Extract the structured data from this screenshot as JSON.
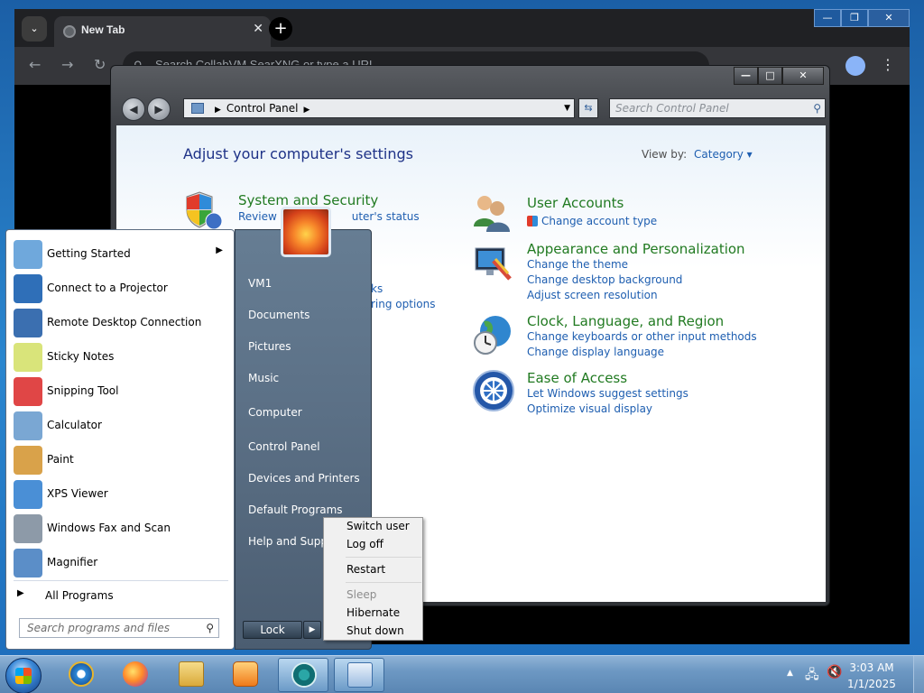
{
  "chrome": {
    "tab_title": "New Tab",
    "tab_close": "✕",
    "new_tab": "+",
    "omnibox_placeholder": "Search CollabVM SearXNG or type a URL",
    "win_min": "—",
    "win_max": "❐",
    "win_close": "✕"
  },
  "control_panel": {
    "address_root": "Control Panel",
    "search_placeholder": "Search Control Panel",
    "heading": "Adjust your computer's settings",
    "view_by_label": "View by:",
    "view_by_value": "Category ▾",
    "categories": [
      {
        "title": "System and Security",
        "icon": "shield-icon",
        "links": [
          "Review your computer's status",
          "",
          "",
          "ks",
          "ring options"
        ]
      },
      {
        "title": "User Accounts",
        "icon": "users-icon",
        "links": [
          "Change account type"
        ]
      },
      {
        "title": "Appearance and Personalization",
        "icon": "monitor-icon",
        "links": [
          "Change the theme",
          "Change desktop background",
          "Adjust screen resolution"
        ]
      },
      {
        "title": "Clock, Language, and Region",
        "icon": "globe-clock-icon",
        "links": [
          "Change keyboards or other input methods",
          "Change display language"
        ]
      },
      {
        "title": "Ease of Access",
        "icon": "ease-of-access-icon",
        "links": [
          "Let Windows suggest settings",
          "Optimize visual display"
        ]
      }
    ],
    "system_link_fragment": "Review y",
    "system_link_fragment2": "uter's status"
  },
  "start_menu": {
    "programs": [
      {
        "label": "Getting Started",
        "icon": "getting-started-icon",
        "submenu": "▶",
        "color": "#6fa8dc"
      },
      {
        "label": "Connect to a Projector",
        "icon": "projector-icon",
        "color": "#2f6fb8"
      },
      {
        "label": "Remote Desktop Connection",
        "icon": "remote-desktop-icon",
        "color": "#3b6fb0"
      },
      {
        "label": "Sticky Notes",
        "icon": "sticky-notes-icon",
        "color": "#d9e47a"
      },
      {
        "label": "Snipping Tool",
        "icon": "scissors-icon",
        "color": "#e04646"
      },
      {
        "label": "Calculator",
        "icon": "calculator-icon",
        "color": "#7aa7d3"
      },
      {
        "label": "Paint",
        "icon": "paint-icon",
        "color": "#d9a24a"
      },
      {
        "label": "XPS Viewer",
        "icon": "xps-viewer-icon",
        "color": "#4a8fd6"
      },
      {
        "label": "Windows Fax and Scan",
        "icon": "fax-scan-icon",
        "color": "#8d9aa8"
      },
      {
        "label": "Magnifier",
        "icon": "magnifier-icon",
        "color": "#5b8ec8"
      }
    ],
    "all_programs": "All Programs",
    "search_placeholder": "Search programs and files",
    "places": [
      "VM1",
      "Documents",
      "Pictures",
      "Music",
      "Computer",
      "Control Panel",
      "Devices and Printers",
      "Default Programs",
      "Help and Support"
    ],
    "lock_label": "Lock",
    "lock_arrow": "▶"
  },
  "power_menu": {
    "items": [
      "Switch user",
      "Log off",
      "Restart",
      "Sleep",
      "Hibernate",
      "Shut down"
    ]
  },
  "taskbar": {
    "apps": [
      "internet-explorer-icon",
      "firefox-icon",
      "file-explorer-icon",
      "media-player-icon",
      "chromium-icon",
      "control-panel-icon"
    ],
    "time": "3:03 AM",
    "date": "1/1/2025",
    "tray_up": "▲"
  }
}
